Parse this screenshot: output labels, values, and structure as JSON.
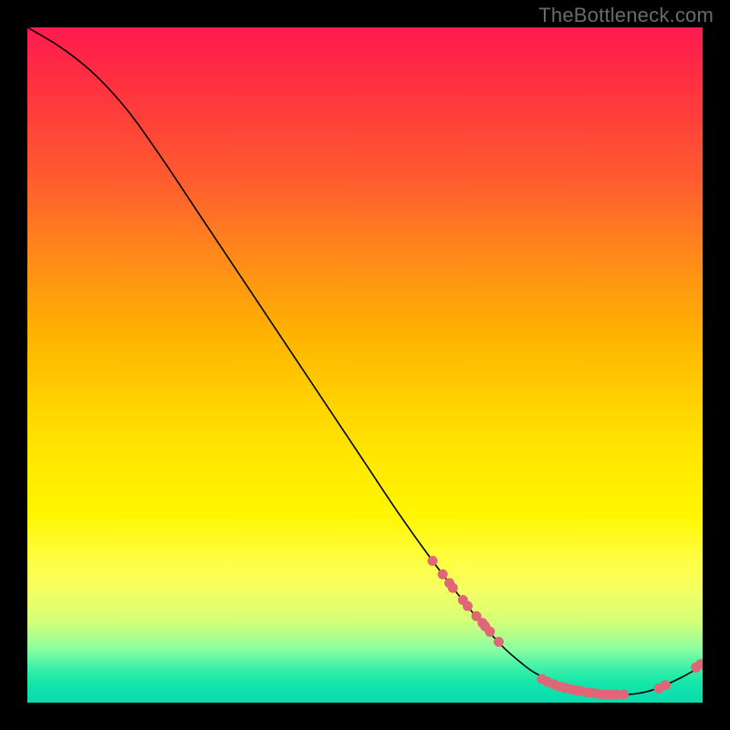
{
  "watermark": "TheBottleneck.com",
  "chart_data": {
    "type": "line",
    "title": "",
    "xlabel": "",
    "ylabel": "",
    "xlim": [
      0,
      100
    ],
    "ylim": [
      0,
      100
    ],
    "grid": false,
    "series": [
      {
        "name": "curve",
        "stroke": "#000000",
        "stroke_width": 1.6,
        "x": [
          0,
          5,
          10,
          15,
          20,
          25,
          30,
          35,
          40,
          45,
          50,
          55,
          60,
          65,
          70,
          73,
          75,
          78,
          80,
          82,
          84,
          86,
          88,
          90,
          92,
          94,
          97,
          100
        ],
        "values": [
          100,
          97,
          93,
          87.5,
          80.5,
          73,
          65.5,
          58,
          50.5,
          43,
          35.5,
          28,
          21,
          14.5,
          8.7,
          6,
          4.5,
          3,
          2.2,
          1.7,
          1.4,
          1.2,
          1.2,
          1.3,
          1.7,
          2.4,
          3.8,
          5.5
        ]
      }
    ],
    "markers": [
      {
        "name": "descent-cluster",
        "color": "#e06677",
        "radius": 5.5,
        "points": [
          {
            "x": 60.0,
            "y": 21.0
          },
          {
            "x": 61.5,
            "y": 19.0
          },
          {
            "x": 62.5,
            "y": 17.7
          },
          {
            "x": 63.0,
            "y": 17.0
          },
          {
            "x": 64.5,
            "y": 15.2
          },
          {
            "x": 65.2,
            "y": 14.3
          },
          {
            "x": 66.5,
            "y": 12.8
          },
          {
            "x": 67.4,
            "y": 11.8
          },
          {
            "x": 67.8,
            "y": 11.3
          },
          {
            "x": 68.5,
            "y": 10.5
          },
          {
            "x": 69.8,
            "y": 9.0
          }
        ]
      },
      {
        "name": "trough-cluster",
        "color": "#e06677",
        "radius": 5.5,
        "points": [
          {
            "x": 76.2,
            "y": 3.5
          },
          {
            "x": 77.0,
            "y": 3.1
          },
          {
            "x": 78.0,
            "y": 2.7
          },
          {
            "x": 78.8,
            "y": 2.4
          },
          {
            "x": 79.6,
            "y": 2.2
          },
          {
            "x": 80.5,
            "y": 2.0
          },
          {
            "x": 81.3,
            "y": 1.8
          },
          {
            "x": 82.0,
            "y": 1.7
          },
          {
            "x": 83.0,
            "y": 1.5
          },
          {
            "x": 83.8,
            "y": 1.4
          },
          {
            "x": 84.6,
            "y": 1.3
          },
          {
            "x": 85.5,
            "y": 1.2
          },
          {
            "x": 86.3,
            "y": 1.2
          },
          {
            "x": 87.2,
            "y": 1.2
          },
          {
            "x": 88.3,
            "y": 1.2
          }
        ]
      },
      {
        "name": "rise-cluster",
        "color": "#e06677",
        "radius": 5.5,
        "points": [
          {
            "x": 93.5,
            "y": 2.1
          },
          {
            "x": 94.5,
            "y": 2.6
          },
          {
            "x": 99.0,
            "y": 5.2
          },
          {
            "x": 99.7,
            "y": 5.7
          }
        ]
      }
    ]
  }
}
